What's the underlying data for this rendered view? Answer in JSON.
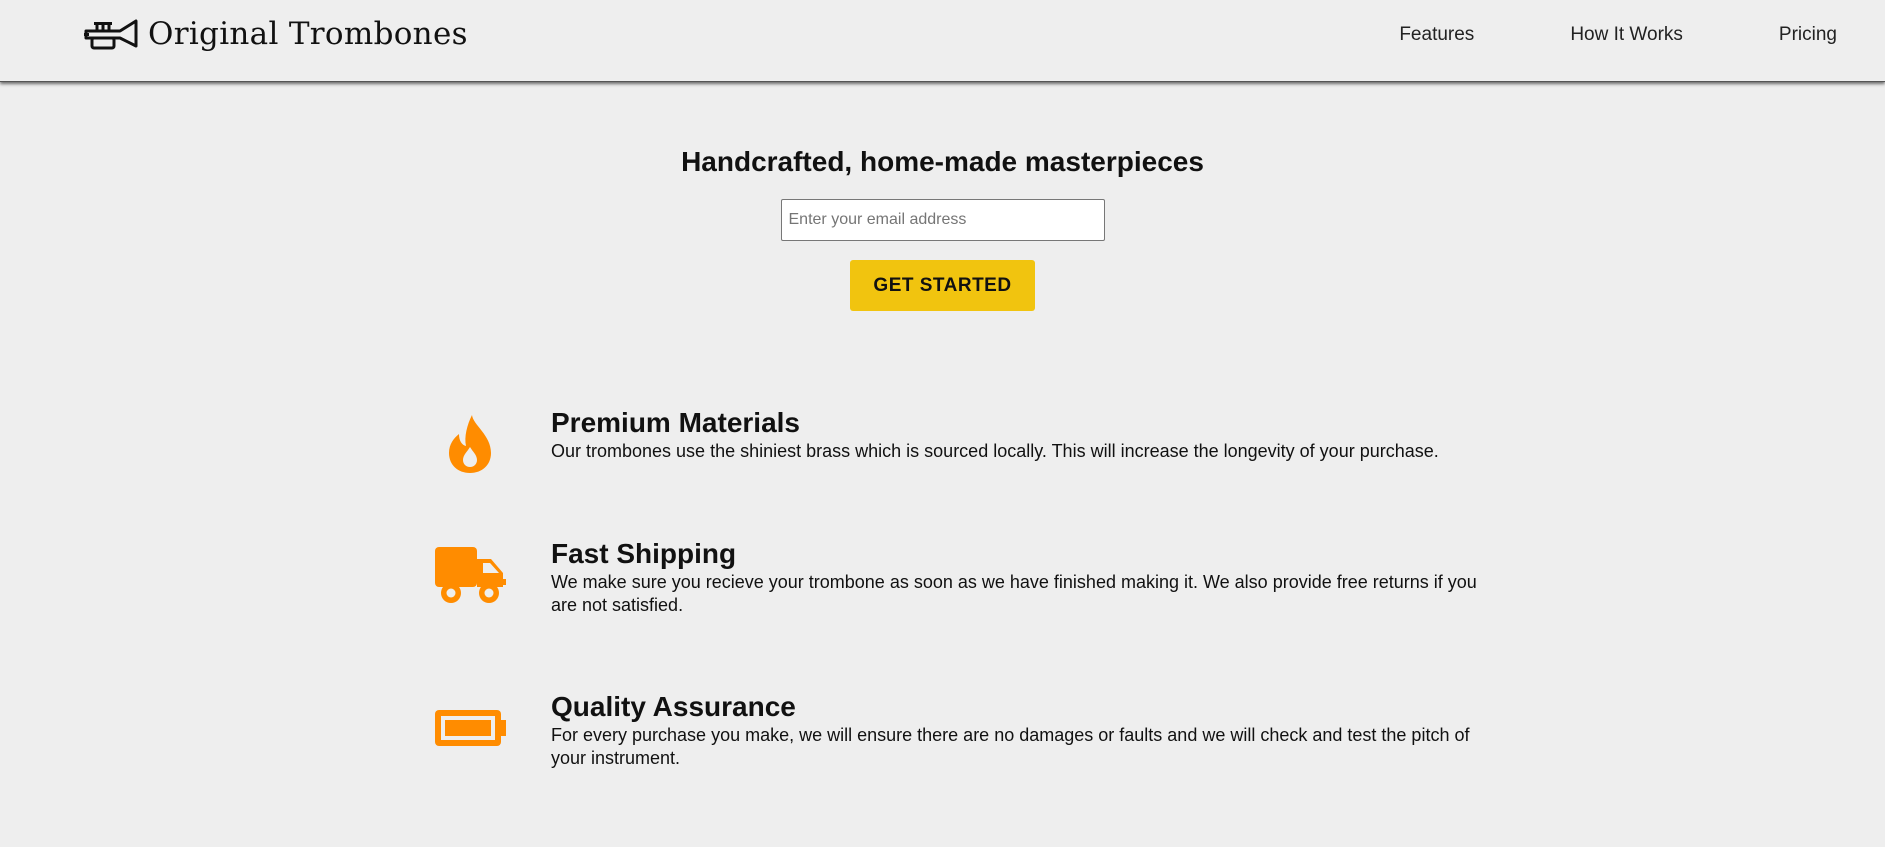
{
  "header": {
    "logo_text": "Original Trombones",
    "logo_icon": "trumpet-icon",
    "nav": [
      {
        "label": "Features"
      },
      {
        "label": "How It Works"
      },
      {
        "label": "Pricing"
      }
    ]
  },
  "hero": {
    "title": "Handcrafted, home-made masterpieces",
    "email_placeholder": "Enter your email address",
    "cta_label": "GET STARTED"
  },
  "features": [
    {
      "icon": "flame-icon",
      "title": "Premium Materials",
      "description": "Our trombones use the shiniest brass which is sourced locally. This will increase the longevity of your purchase."
    },
    {
      "icon": "truck-icon",
      "title": "Fast Shipping",
      "description": "We make sure you recieve your trombone as soon as we have finished making it. We also provide free returns if you are not satisfied."
    },
    {
      "icon": "battery-icon",
      "title": "Quality Assurance",
      "description": "For every purchase you make, we will ensure there are no damages or faults and we will check and test the pitch of your instrument."
    }
  ],
  "colors": {
    "background": "#eeeeee",
    "accent_button": "#f1c40f",
    "icon_orange": "#ff8c00"
  }
}
